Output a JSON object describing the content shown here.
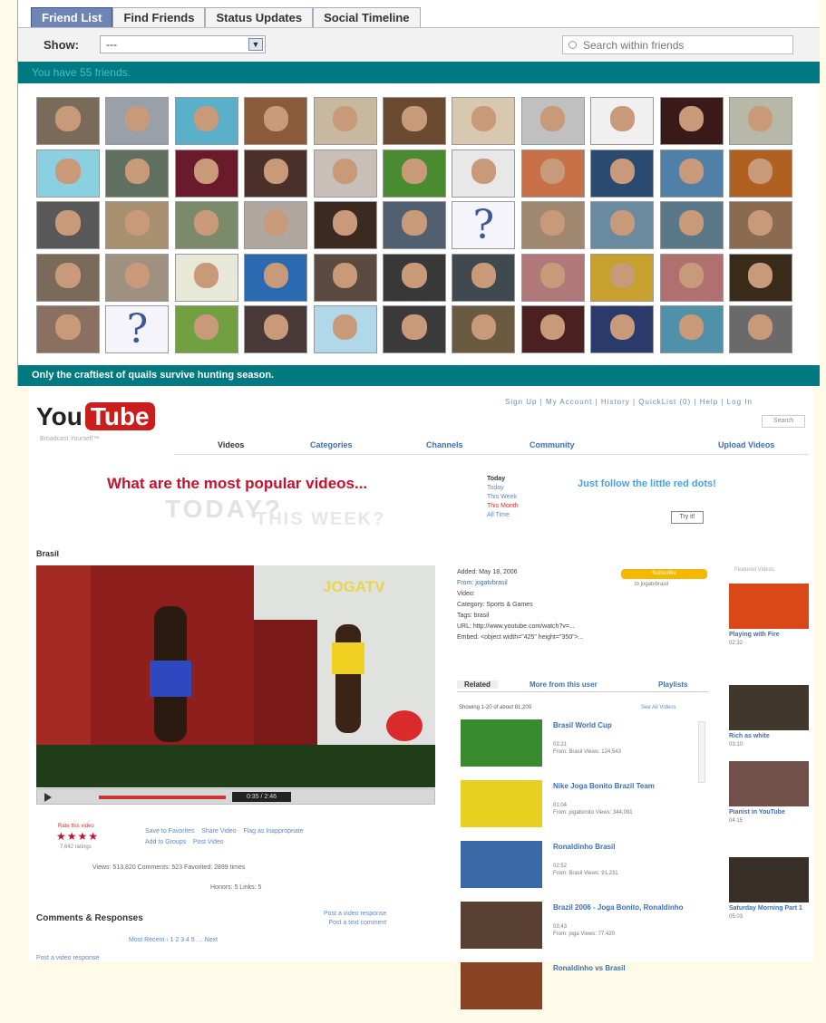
{
  "facebook": {
    "tabs": [
      "Friend List",
      "Find Friends",
      "Status Updates",
      "Social Timeline"
    ],
    "show_label": "Show:",
    "show_value": "---",
    "search_placeholder": "Search within friends",
    "friend_count_text": "You have 55 friends.",
    "tagline": "Only the craftiest of quails survive hunting season.",
    "accent_color": "#007a80",
    "friend_photos": [
      "#7a6a5a",
      "#9aa0a8",
      "#5ab0c8",
      "#8a5a3a",
      "#c8b8a0",
      "#6a4a30",
      "#d8c8b0",
      "#c0c0c0",
      "#f0f0f0",
      "#3a1a18",
      "#b8b8a8",
      "#8ad0e0",
      "#607060",
      "#6a1a2a",
      "#4a3028",
      "#c8c0b8",
      "#4a8a30",
      "#e8e8e8",
      "#c87048",
      "#2a4a70",
      "#5080a8",
      "#b06020",
      "#585858",
      "#a89070",
      "#7a8a6a",
      "#b0a8a0",
      "#3a2a20",
      "#506070",
      "q",
      "#a08870",
      "#6a8aa0",
      "#5a7888",
      "#8a6a50",
      "#7a6a5a",
      "#a09080",
      "#e8e8d8",
      "#2a6ab0",
      "#5a4a40",
      "#383838",
      "#404850",
      "#b07878",
      "#c8a030",
      "#b07070",
      "#3a2a1a",
      "#8a7060",
      "q",
      "#70a040",
      "#483838",
      "#b0d8e8",
      "#3a3a3a",
      "#6a5a40",
      "#4a2020",
      "#2a3a6a",
      "#5090a8",
      "#6a6a6a"
    ]
  },
  "youtube": {
    "logo_you": "You",
    "logo_tube": "Tube",
    "logo_sub": "Broadcast Yourself™",
    "top_links": "Sign Up | My Account | History | QuickList (0) | Help | Log In",
    "search_button": "Search",
    "nav": [
      "Videos",
      "Categories",
      "Channels",
      "Community",
      "Upload Videos"
    ],
    "promo_headline": "What are the most popular videos...",
    "promo_ghost_1": "TODAY?",
    "promo_ghost_2": "THIS WEEK?",
    "promo_options": [
      "Today",
      "Today",
      "This Week",
      "This Month",
      "All Time"
    ],
    "promo_follow": "Just follow the little red dots!",
    "promo_box": "Try it!",
    "video_title": "Brasil",
    "watermark": "JOGATV",
    "player_time": "0:35 / 2:46",
    "rating_label": "Rate this video",
    "stars": "★★★★",
    "ratings_count": "7,642 ratings",
    "actions": [
      "Save to Favorites",
      "Add to Groups",
      "Share Video",
      "Post Video",
      "Flag as Inappropriate"
    ],
    "stats": "Views: 513,820    Comments: 523    Favorited: 2899 times",
    "stats2": "Honors: 5    Links: 5",
    "comments_title": "Comments & Responses",
    "post_links": [
      "Post a video response",
      "Post a text comment"
    ],
    "pager": "Most Recent  ‹  1  2  3  4  5  …  Next",
    "bottom_link": "Post a video response",
    "info_lines": [
      "Added: May 18, 2006",
      "From: jogatvbrasil",
      "Video:",
      "Category: Sports & Games",
      "Tags: brasil",
      "URL: http://www.youtube.com/watch?v=...",
      "Embed: <object width=\"425\" height=\"350\">..."
    ],
    "subscribe_label": "Subscribe",
    "subscribe_count": "to jogatvbrasil",
    "related_tabs": [
      "Related",
      "More from this user",
      "Playlists"
    ],
    "showing_text": "Showing 1-20 of about 81,200",
    "see_all": "See All Videos",
    "related": [
      {
        "title": "Brasil World Cup",
        "duration": "03:21",
        "meta": "From: Brasil\nViews: 124,543",
        "color": "#3a8a30"
      },
      {
        "title": "Nike Joga Bonito Brazil Team",
        "duration": "01:04",
        "meta": "From: jogabonito\nViews: 344,091",
        "color": "#e8d020"
      },
      {
        "title": "Ronaldinho Brasil",
        "duration": "02:52",
        "meta": "From: Brasil\nViews: 91,231",
        "color": "#3a6aa8"
      },
      {
        "title": "Brazil 2006 - Joga Bonito, Ronaldinho",
        "duration": "03:43",
        "meta": "From: joga\nViews: 77,420",
        "color": "#5a4030"
      },
      {
        "title": "Ronaldinho vs Brasil",
        "duration": "",
        "meta": "",
        "color": "#884422"
      }
    ],
    "featured_label": "Featured Videos",
    "featured": [
      {
        "title": "Playing with Fire",
        "meta": "02:32",
        "color": "#d84818"
      },
      {
        "title": "Rich as white",
        "meta": "03:10",
        "color": "#40382a"
      },
      {
        "title": "Pianist in YouTube",
        "meta": "04:15",
        "color": "#705048"
      },
      {
        "title": "Saturday Morning Part 1",
        "meta": "05:03",
        "color": "#383028"
      }
    ]
  }
}
